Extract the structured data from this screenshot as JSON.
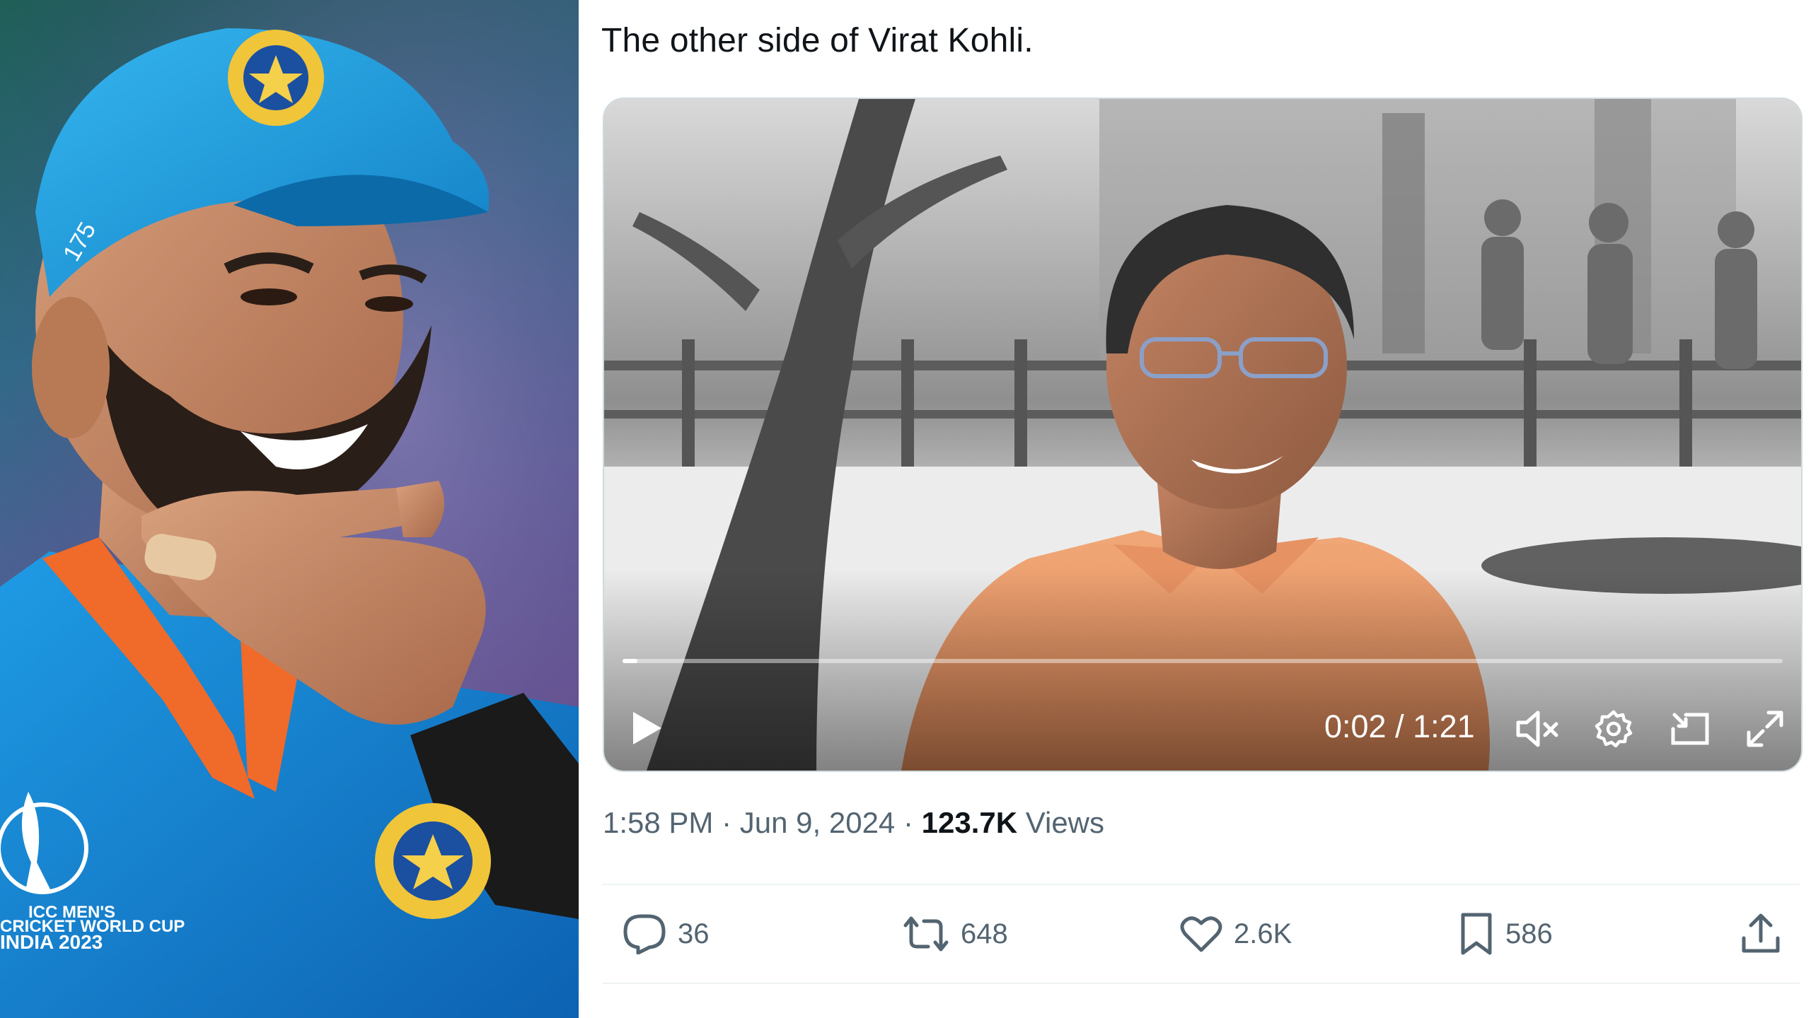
{
  "photo": {
    "jersey_logo_text_line1": "ICC MEN'S",
    "jersey_logo_text_line2": "CRICKET WORLD CUP",
    "jersey_logo_text_line3": "INDIA 2023",
    "cap_number": "175"
  },
  "tweet": {
    "text": "The other side of Virat Kohli.",
    "video": {
      "current_time": "0:02",
      "duration": "1:21",
      "time_display": "0:02 / 1:21",
      "progress_fraction": 0.013,
      "muted": true
    },
    "meta": {
      "time": "1:58 PM",
      "separator": "·",
      "date": "Jun 9, 2024",
      "views_count": "123.7K",
      "views_label": "Views"
    },
    "actions": {
      "reply_count": "36",
      "repost_count": "648",
      "like_count": "2.6K",
      "bookmark_count": "586"
    }
  },
  "colors": {
    "text_primary": "#0f1419",
    "text_secondary": "#536471",
    "divider": "#eff3f4",
    "jersey_blue": "#1a8fd6",
    "cap_blue": "#1ba3e0"
  },
  "icons": {
    "play": "play-icon",
    "mute": "volume-muted-icon",
    "settings": "gear-icon",
    "pip": "picture-in-picture-icon",
    "fullscreen": "fullscreen-icon",
    "reply": "reply-bubble-icon",
    "repost": "repost-icon",
    "like": "heart-icon",
    "bookmark": "bookmark-icon",
    "share": "share-icon"
  }
}
